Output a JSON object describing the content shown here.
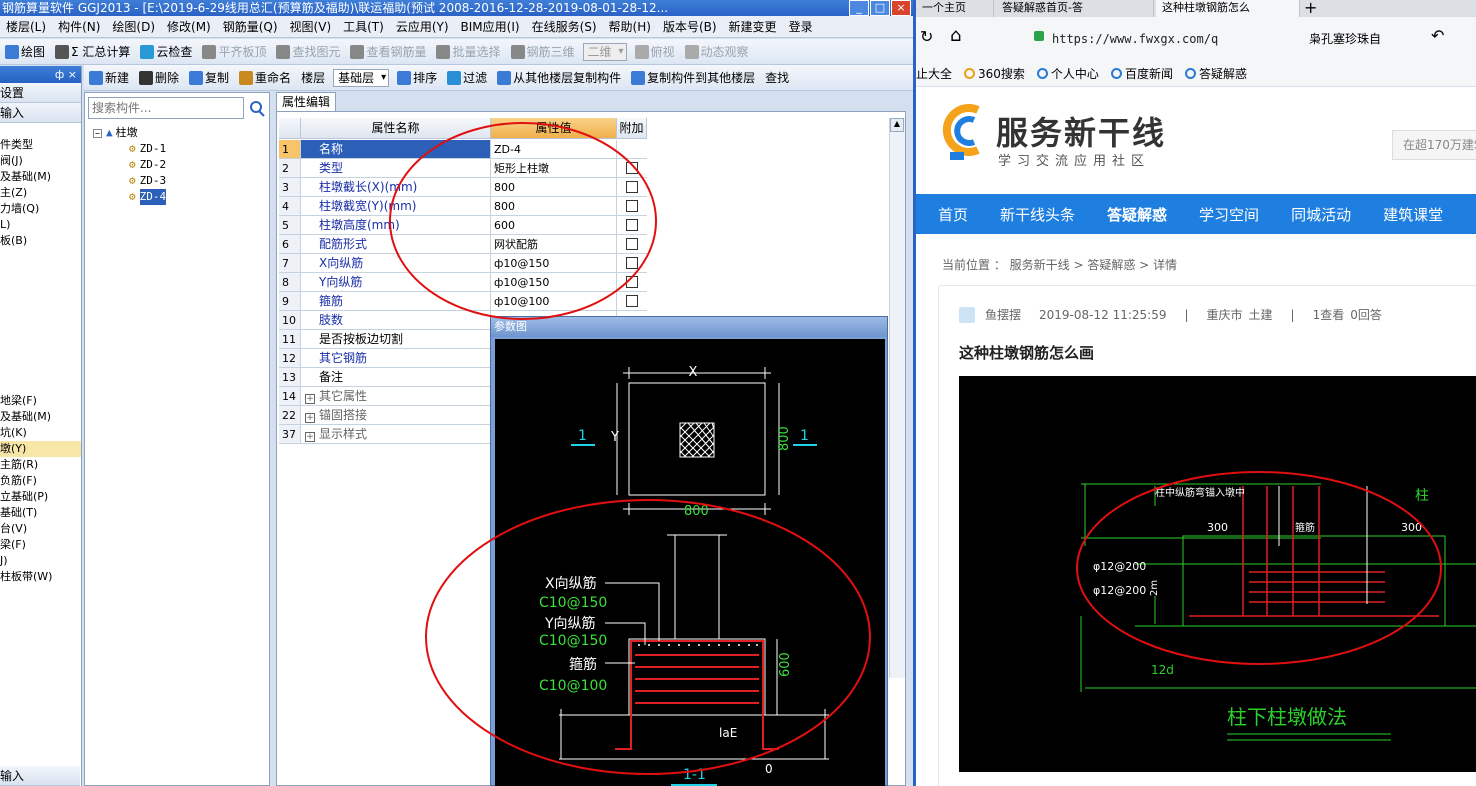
{
  "left_app": {
    "title": "钢筋算量软件 GGJ2013 - [E:\\2019-6-29线用总汇(预算筋及福助)\\联运福助(预试 2008-2016-12-28-2019-08-01-28-12...",
    "menus": [
      "楼层(L)",
      "构件(N)",
      "绘图(D)",
      "修改(M)",
      "钢筋量(Q)",
      "视图(V)",
      "工具(T)",
      "云应用(Y)",
      "BIM应用(I)",
      "在线服务(S)",
      "帮助(H)",
      "版本号(B)",
      "新建变更",
      "登录"
    ],
    "toolbar1": {
      "items": [
        "绘图",
        "Σ 汇总计算",
        "云检查",
        "平齐板顶",
        "查找图元",
        "查看钢筋量",
        "批量选择",
        "钢筋三维",
        "二维",
        "俯视",
        "动态观察"
      ]
    },
    "toolbar2": {
      "items": [
        "新建",
        "删除",
        "复制",
        "重命名",
        "楼层",
        "基础层",
        "排序",
        "过滤",
        "从其他楼层复制构件",
        "复制构件到其他楼层",
        "查找"
      ]
    },
    "panel1": {
      "header": "设置",
      "subheader": "输入",
      "items": [
        "件类型",
        "阀(J)",
        "及基础(M)",
        "主(Z)",
        "力墙(Q)",
        "L)",
        "板(B)",
        "",
        "",
        "",
        "",
        "",
        "",
        "",
        "",
        "",
        "地梁(F)",
        "及基础(M)",
        "坑(K)",
        "墩(Y)",
        "主筋(R)",
        "负筋(F)",
        "立基础(P)",
        "基础(T)",
        "台(V)",
        "梁(F)",
        "J)",
        "柱板带(W)"
      ],
      "footer": "输入"
    },
    "panel2": {
      "search_placeholder": "搜索构件...",
      "tree_root": "柱墩",
      "tree_items": [
        "ZD-1",
        "ZD-2",
        "ZD-3",
        "ZD-4"
      ],
      "selected": "ZD-4"
    },
    "prop_tab": "属性编辑",
    "grid": {
      "headers": [
        "属性名称",
        "属性值",
        "附加"
      ],
      "rows": [
        {
          "no": "1",
          "name": "名称",
          "value": "ZD-4",
          "check": false,
          "style": "blue"
        },
        {
          "no": "2",
          "name": "类型",
          "value": "矩形上柱墩",
          "check": true,
          "style": "blue"
        },
        {
          "no": "3",
          "name": "柱墩截长(X)(mm)",
          "value": "800",
          "check": true,
          "style": "blue"
        },
        {
          "no": "4",
          "name": "柱墩截宽(Y)(mm)",
          "value": "800",
          "check": true,
          "style": "blue"
        },
        {
          "no": "5",
          "name": "柱墩高度(mm)",
          "value": "600",
          "check": true,
          "style": "blue"
        },
        {
          "no": "6",
          "name": "配筋形式",
          "value": "网状配筋",
          "check": true,
          "style": "blue"
        },
        {
          "no": "7",
          "name": "X向纵筋",
          "value": "ф10@150",
          "check": true,
          "style": "blue"
        },
        {
          "no": "8",
          "name": "Y向纵筋",
          "value": "ф10@150",
          "check": true,
          "style": "blue"
        },
        {
          "no": "9",
          "name": "箍筋",
          "value": "ф10@100",
          "check": true,
          "style": "blue"
        },
        {
          "no": "10",
          "name": "肢数",
          "value": "",
          "check": false,
          "style": "blue"
        },
        {
          "no": "11",
          "name": "是否按板边切割",
          "value": "",
          "check": false,
          "style": "black"
        },
        {
          "no": "12",
          "name": "其它钢筋",
          "value": "",
          "check": false,
          "style": "blue"
        },
        {
          "no": "13",
          "name": "备注",
          "value": "",
          "check": false,
          "style": "black"
        },
        {
          "no": "14",
          "name": "其它属性",
          "value": "",
          "check": false,
          "style": "gray",
          "plus": true
        },
        {
          "no": "22",
          "name": "锚固搭接",
          "value": "",
          "check": false,
          "style": "gray",
          "plus": true
        },
        {
          "no": "37",
          "name": "显示样式",
          "value": "",
          "check": false,
          "style": "gray",
          "plus": true
        }
      ]
    },
    "param_dialog": {
      "title": "参数图",
      "labels": {
        "x": "X",
        "y": "Y",
        "sec": "1",
        "dim800a": "800",
        "dim800b": "800",
        "xbar": "X向纵筋",
        "xbar_val": "C10@150",
        "ybar": "Y向纵筋",
        "ybar_val": "C10@150",
        "stir": "箍筋",
        "stir_val": "C10@100",
        "h600": "600",
        "lae": "laE",
        "zero": "0",
        "section": "1-1"
      }
    }
  },
  "browser": {
    "tabs": [
      "一个主页",
      "答疑解惑首页-答",
      "这种柱墩钢筋怎么"
    ],
    "url": "https://www.fwxgx.com/q",
    "addr_right": "枭孔塞珍珠自",
    "bookmarks": [
      "止大全",
      "360搜索",
      "个人中心",
      "百度新闻",
      "答疑解惑"
    ],
    "logo_title": "服务新干线",
    "logo_sub": "学习交流应用社区",
    "search_hint": "在超170万建筑",
    "nav": [
      "首页",
      "新干线头条",
      "答疑解惑",
      "学习空间",
      "同城活动",
      "建筑课堂"
    ],
    "breadcrumb": "当前位置 ： 服务新干线 > 答疑解惑 > 详情",
    "meta": {
      "user": "鱼摆摆",
      "time": "2019-08-12 11:25:59",
      "city": "重庆市",
      "major": "土建",
      "views": "1查看",
      "answers": "0回答"
    },
    "question": "这种柱墩钢筋怎么画",
    "cad": {
      "top_label": "柱中纵筋弯锚入墩中",
      "col": "柱",
      "d300a": "300",
      "d300b": "300",
      "mid": "箍筋",
      "left1": "φ12@200",
      "left2": "φ12@200",
      "h": "2m",
      "d12a": "12d",
      "d12b": "12d",
      "title": "柱下柱墩做法"
    }
  }
}
